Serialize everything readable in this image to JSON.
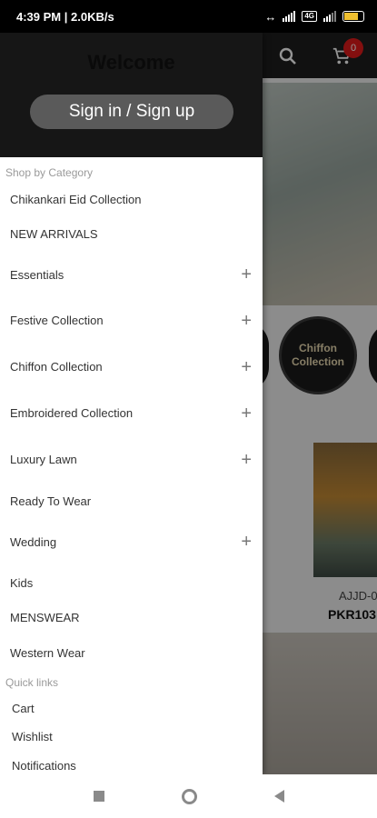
{
  "status_bar": {
    "left_text": "4:39 PM | 2.0KB/s",
    "badge_text": "4G",
    "battery_level": 0.75
  },
  "app": {
    "cart_count": "0",
    "circle_category": "Chiffon Collection",
    "product_code": "AJJD-0",
    "product_price": "PKR103"
  },
  "drawer": {
    "welcome": "Welcome",
    "signin_label": "Sign in / Sign up",
    "shop_by_category_label": "Shop by Category",
    "categories": [
      {
        "label": "Chikankari Eid Collection",
        "expandable": false
      },
      {
        "label": "NEW ARRIVALS",
        "expandable": false
      },
      {
        "label": "Essentials",
        "expandable": true
      },
      {
        "label": "Festive Collection",
        "expandable": true
      },
      {
        "label": "Chiffon Collection",
        "expandable": true
      },
      {
        "label": "Embroidered Collection",
        "expandable": true
      },
      {
        "label": "Luxury Lawn",
        "expandable": true
      },
      {
        "label": "Ready To Wear",
        "expandable": false
      },
      {
        "label": "Wedding",
        "expandable": true
      },
      {
        "label": "Kids",
        "expandable": false
      },
      {
        "label": "MENSWEAR",
        "expandable": false
      },
      {
        "label": "Western Wear",
        "expandable": false
      }
    ],
    "quick_links_label": "Quick links",
    "quick_links": [
      "Cart",
      "Wishlist",
      "Notifications"
    ]
  },
  "icons": {
    "search": "search-icon",
    "cart": "cart-icon",
    "expand": "plus-icon",
    "nav_recents": "square-icon",
    "nav_home": "circle-icon",
    "nav_back": "triangle-back-icon"
  },
  "colors": {
    "header_bg": "#161616",
    "signin_bg": "#5a5a5a",
    "cart_badge": "#e21b1b"
  }
}
